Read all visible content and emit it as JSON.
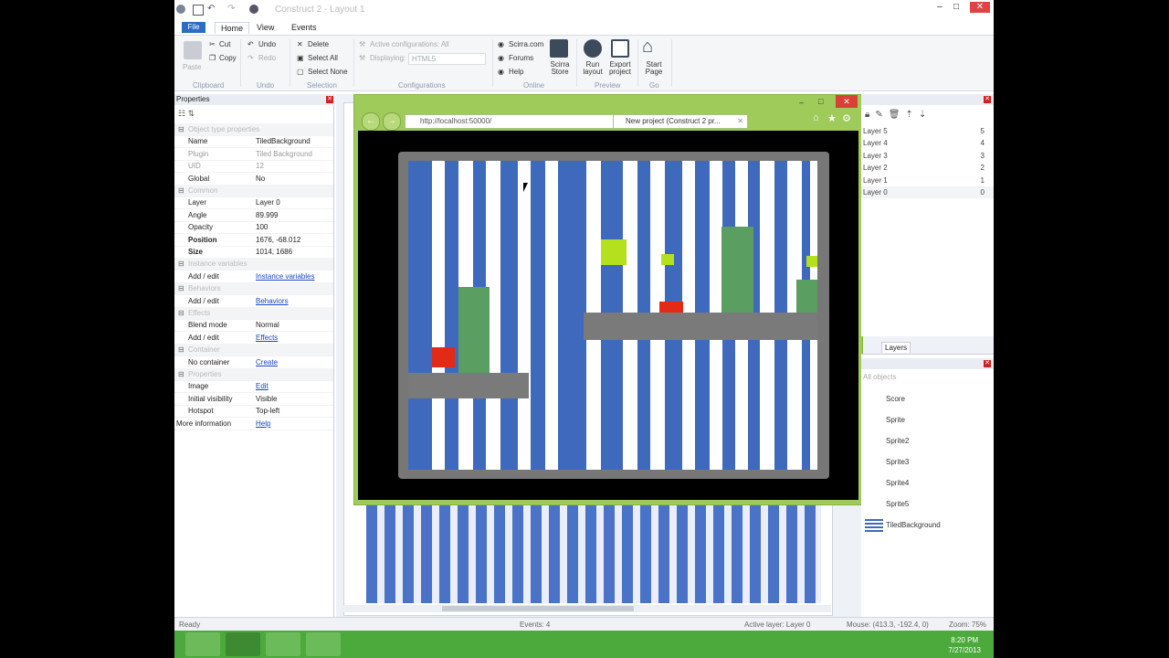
{
  "window": {
    "title": "Construct 2 - Layout 1",
    "min_glyph": "–",
    "max_glyph": "□",
    "close_glyph": "✕"
  },
  "ribbon": {
    "file_label": "File",
    "tabs": [
      "Home",
      "View",
      "Events"
    ],
    "clipboard": {
      "paste": "Paste",
      "cut": "Cut",
      "copy": "Copy",
      "group": "Clipboard"
    },
    "undo": {
      "undo": "Undo",
      "redo": "Redo",
      "group": "Undo"
    },
    "selection": {
      "delete": "Delete",
      "select_all": "Select All",
      "select_none": "Select None",
      "group": "Selection"
    },
    "configurations": {
      "active": "Active configurations: All",
      "displaying_label": "Displaying:",
      "displaying_value": "HTML5",
      "group": "Configurations"
    },
    "online": {
      "scirra": "Scirra.com",
      "forums": "Forums",
      "help": "Help",
      "store": "Scirra Store",
      "group": "Online"
    },
    "preview": {
      "run": "Run layout",
      "export": "Export project",
      "group": "Preview"
    },
    "go": {
      "start": "Start Page",
      "group": "Go"
    }
  },
  "properties": {
    "title": "Properties",
    "rows": [
      {
        "k": "Object type properties",
        "v": "",
        "cat": true
      },
      {
        "k": "Name",
        "v": "TiledBackground"
      },
      {
        "k": "Plugin",
        "v": "Tiled Background",
        "dim": true
      },
      {
        "k": "UID",
        "v": "12",
        "dim": true
      },
      {
        "k": "Global",
        "v": "No"
      },
      {
        "k": "Common",
        "v": "",
        "cat": true
      },
      {
        "k": "Layer",
        "v": "Layer 0"
      },
      {
        "k": "Angle",
        "v": "89.999"
      },
      {
        "k": "Opacity",
        "v": "100"
      },
      {
        "k": "Position",
        "v": "1676, -68.012",
        "bold": true
      },
      {
        "k": "Size",
        "v": "1014, 1686",
        "bold": true
      },
      {
        "k": "Instance variables",
        "v": "",
        "cat": true
      },
      {
        "k": "Add / edit",
        "v": "Instance variables",
        "link": true
      },
      {
        "k": "Behaviors",
        "v": "",
        "cat": true
      },
      {
        "k": "Add / edit",
        "v": "Behaviors",
        "link": true
      },
      {
        "k": "Effects",
        "v": "",
        "cat": true
      },
      {
        "k": "Blend mode",
        "v": "Normal"
      },
      {
        "k": "Add / edit",
        "v": "Effects",
        "link": true
      },
      {
        "k": "Container",
        "v": "",
        "cat": true
      },
      {
        "k": "No container",
        "v": "Create",
        "link": true
      },
      {
        "k": "Properties",
        "v": "",
        "cat": true
      },
      {
        "k": "Image",
        "v": "Edit",
        "link": true
      },
      {
        "k": "Initial visibility",
        "v": "Visible"
      },
      {
        "k": "Hotspot",
        "v": "Top-left"
      },
      {
        "k": "More information",
        "v": "Help",
        "link": true,
        "left": true
      }
    ]
  },
  "browser": {
    "address": "http://localhost:50000/",
    "tab_label": "New project (Construct 2 pr...",
    "close_glyph": "✕",
    "back_glyph": "←",
    "fwd_glyph": "→"
  },
  "layers": {
    "rows": [
      {
        "name": "Layer 5",
        "index": "5"
      },
      {
        "name": "Layer 4",
        "index": "4"
      },
      {
        "name": "Layer 3",
        "index": "3"
      },
      {
        "name": "Layer 2",
        "index": "2"
      },
      {
        "name": "Layer 1",
        "index": "1"
      },
      {
        "name": "Layer 0",
        "index": "0"
      }
    ],
    "tab_label": "Layers"
  },
  "objects": {
    "filter_placeholder": "All objects",
    "items": [
      "Score",
      "Sprite",
      "Sprite2",
      "Sprite3",
      "Sprite4",
      "Sprite5",
      "TiledBackground"
    ]
  },
  "status": {
    "ready": "Ready",
    "events": "Events: 4",
    "active_layer": "Active layer: Layer 0",
    "mouse": "Mouse: (413.3, -192.4, 0)",
    "zoom": "Zoom: 75%"
  },
  "clock": {
    "time": "8:20 PM",
    "date": "7/27/2013"
  },
  "colors": {
    "field_blue": "#3f69bd",
    "platform_gray": "#7a7a7a",
    "player_red": "#e22a16",
    "enemy_green": "#5a9e62",
    "coin_lime": "#b4e01e",
    "browser_green": "#9fcb5a",
    "taskbar_green": "#4caa3c"
  }
}
